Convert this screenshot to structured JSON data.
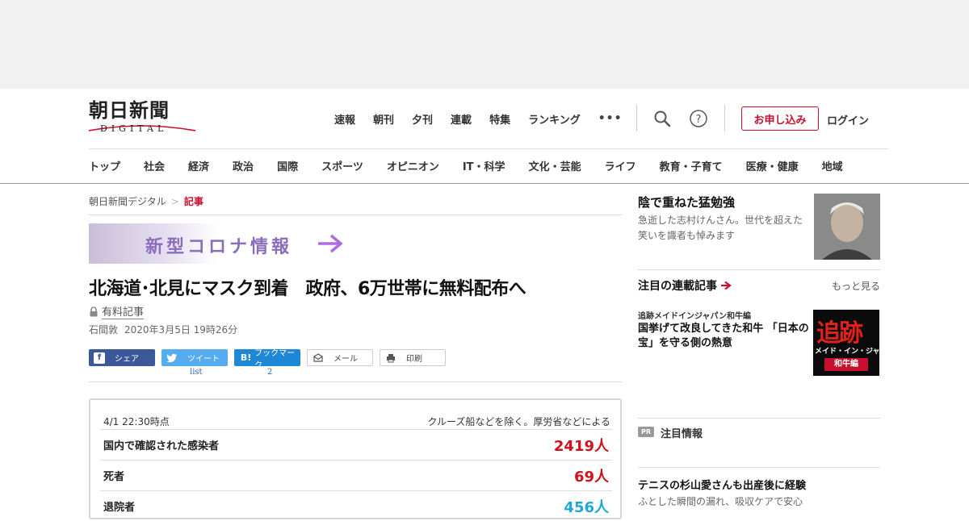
{
  "logo": {
    "main": "朝日新聞",
    "sub": "DIGITAL"
  },
  "topnav": [
    "速報",
    "朝刊",
    "夕刊",
    "連載",
    "特集",
    "ランキング"
  ],
  "topnav_more": "•••",
  "header": {
    "apply": "お申し込み",
    "login": "ログイン"
  },
  "categories": [
    "トップ",
    "社会",
    "経済",
    "政治",
    "国際",
    "スポーツ",
    "オピニオン",
    "IT・科学",
    "文化・芸能",
    "ライフ",
    "教育・子育て",
    "医療・健康",
    "地域"
  ],
  "breadcrumb": {
    "home": "朝日新聞デジタル",
    "sep": ">",
    "current": "記事"
  },
  "banner": {
    "text": "新型コロナ情報"
  },
  "article": {
    "headline": "北海道･北見にマスク到着　政府、6万世帯に無料配布へ",
    "paid_label": "有料記事",
    "author": "石間敦",
    "date": "2020年3月5日 19時26分"
  },
  "share": {
    "facebook": "シェア",
    "twitter": "ツイート",
    "twitter_count": "list",
    "hatena": "ブックマーク",
    "hatena_icon": "B!",
    "hatena_count": "2",
    "mail": "メール",
    "print": "印刷"
  },
  "stats": {
    "timestamp": "4/1 22:30時点",
    "note": "クルーズ船などを除く。厚労省などによる",
    "rows": [
      {
        "label": "国内で確認された感染者",
        "value": "2419人",
        "color": "#d0121b"
      },
      {
        "label": "死者",
        "value": "69人",
        "color": "#d0121b"
      },
      {
        "label": "退院者",
        "value": "456人",
        "color": "#1fa7d8"
      }
    ]
  },
  "sidebar": {
    "feature_title": "陰で重ねた猛勉強",
    "feature_desc": "急逝した志村けんさん。世代を超えた笑いを識者も悼みます",
    "section": "注目の連載記事",
    "more": "もっと見る",
    "kicker": "追跡メイドインジャパン和牛編",
    "article": "国挙げて改良してきた和牛 「日本の宝」を守る側の熱意",
    "thumb_big": "追跡",
    "thumb_mid": "メイド・イン・ジャパン",
    "thumb_bot": "和牛編",
    "pr_badge": "PR",
    "pr_title": "注目情報",
    "pr_article": "テニスの杉山愛さんも出産後に経験",
    "pr_desc": "ふとした瞬間の漏れ、吸収ケアで安心"
  },
  "colors": {
    "accent": "#c8102e",
    "corona": "#8a6dbb"
  }
}
